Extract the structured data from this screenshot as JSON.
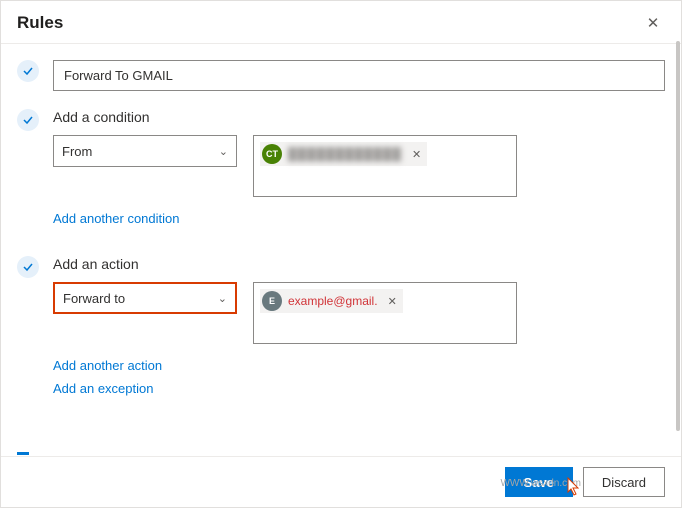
{
  "dialog": {
    "title": "Rules"
  },
  "rule_name": {
    "value": "Forward To GMAIL"
  },
  "condition_section": {
    "heading": "Add a condition",
    "dropdown_value": "From",
    "contact": {
      "initials": "CT",
      "display_name": "████████████"
    },
    "add_another_label": "Add another condition"
  },
  "action_section": {
    "heading": "Add an action",
    "dropdown_value": "Forward to",
    "contact": {
      "initials": "E",
      "display_name": "example@gmail."
    },
    "add_another_label": "Add another action",
    "add_exception_label": "Add an exception"
  },
  "footer": {
    "save_label": "Save",
    "discard_label": "Discard"
  },
  "watermark": "WWW.wsxdn.com"
}
